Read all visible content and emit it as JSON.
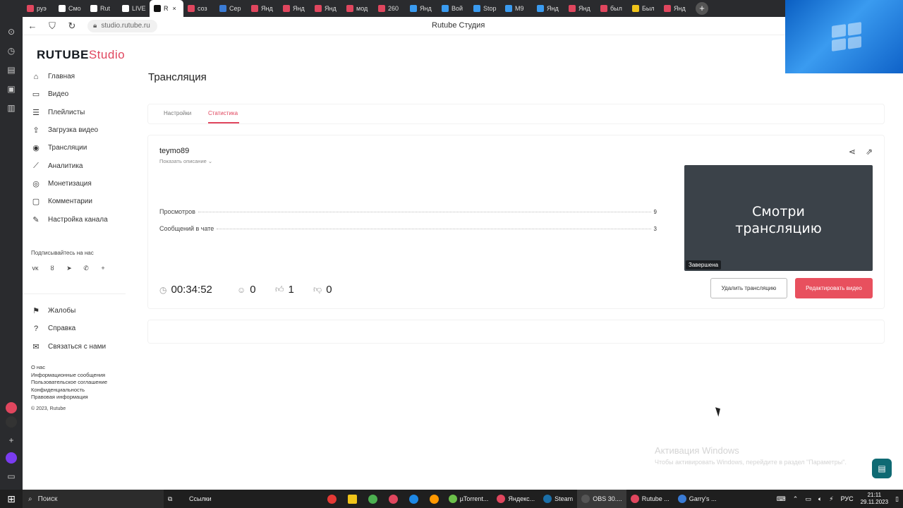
{
  "browser": {
    "tabs": [
      {
        "label": "руэ",
        "color": "#e0465e"
      },
      {
        "label": "Смо",
        "color": "#ffffff"
      },
      {
        "label": "Rut",
        "color": "#ffffff"
      },
      {
        "label": "LIVE",
        "color": "#ffffff"
      },
      {
        "label": "R",
        "color": "#111111",
        "active": true
      },
      {
        "label": "соз",
        "color": "#e0465e"
      },
      {
        "label": "Сер",
        "color": "#3a7bd5"
      },
      {
        "label": "Янд",
        "color": "#e0465e"
      },
      {
        "label": "Янд",
        "color": "#e0465e"
      },
      {
        "label": "Янд",
        "color": "#e0465e"
      },
      {
        "label": "мод",
        "color": "#e0465e"
      },
      {
        "label": "260",
        "color": "#e0465e"
      },
      {
        "label": "Янд",
        "color": "#3a9bf0"
      },
      {
        "label": "Вой",
        "color": "#3a9bf0"
      },
      {
        "label": "Stop",
        "color": "#3a9bf0"
      },
      {
        "label": "M9",
        "color": "#3a9bf0"
      },
      {
        "label": "Янд",
        "color": "#3a9bf0"
      },
      {
        "label": "Янд",
        "color": "#e0465e"
      },
      {
        "label": "был",
        "color": "#e0465e"
      },
      {
        "label": "Был",
        "color": "#f0c419"
      },
      {
        "label": "Янд",
        "color": "#e0465e"
      }
    ],
    "tab_close": "×",
    "new_tab": "+",
    "url": "studio.rutube.ru",
    "page_title": "Rutube Студия"
  },
  "sidebar": {
    "brand_main": "RUTUBE",
    "brand_accent": "Studio",
    "menu": [
      {
        "label": "Главная",
        "icon": "⌂",
        "name": "home"
      },
      {
        "label": "Видео",
        "icon": "▭",
        "name": "video"
      },
      {
        "label": "Плейлисты",
        "icon": "☰",
        "name": "playlists"
      },
      {
        "label": "Загрузка видео",
        "icon": "⇪",
        "name": "upload"
      },
      {
        "label": "Трансляции",
        "icon": "◉",
        "name": "streams"
      },
      {
        "label": "Аналитика",
        "icon": "⟋",
        "name": "analytics"
      },
      {
        "label": "Монетизация",
        "icon": "◎",
        "name": "monetization"
      },
      {
        "label": "Комментарии",
        "icon": "▢",
        "name": "comments"
      },
      {
        "label": "Настройка канала",
        "icon": "✎",
        "name": "channel-settings"
      }
    ],
    "subscribe_label": "Подписывайтесь на нас",
    "socials": [
      "vk",
      "ok",
      "tg",
      "viber",
      "+"
    ],
    "socials_glyphs": [
      "ᴠᴋ",
      "ȣ",
      "➤",
      "✆",
      "+"
    ],
    "menu2": [
      {
        "label": "Жалобы",
        "icon": "⚑",
        "name": "complaints"
      },
      {
        "label": "Справка",
        "icon": "?",
        "name": "help"
      },
      {
        "label": "Связаться с нами",
        "icon": "✉",
        "name": "contact"
      }
    ],
    "links": [
      "О нас",
      "Информационные сообщения",
      "Пользовательское соглашение",
      "Конфиденциальность",
      "Правовая информация"
    ],
    "copyright": "© 2023, Rutube"
  },
  "main": {
    "title": "Трансляция",
    "tabs": [
      {
        "label": "Настройки"
      },
      {
        "label": "Статистика",
        "active": true
      }
    ],
    "stream": {
      "name": "teymo89",
      "show_description": "Показать описание ⌄",
      "stats": [
        {
          "label": "Просмотров",
          "value": "9"
        },
        {
          "label": "Сообщений в чате",
          "value": "3"
        }
      ],
      "duration": "00:34:52",
      "comments": "0",
      "likes": "1",
      "dislikes": "0",
      "thumbnail_text_line1": "Смотри",
      "thumbnail_text_line2": "трансляцию",
      "status_badge": "Завершена",
      "delete_button": "Удалить трансляцию",
      "edit_button": "Редактировать видео"
    }
  },
  "overlay": {
    "activation_title": "Активация Windows",
    "activation_text": "Чтобы активировать Windows, перейдите в раздел \"Параметры\"."
  },
  "taskbar": {
    "search": "Поиск",
    "links": "Ссылки",
    "items": [
      {
        "label": "µTorrent...",
        "color": "#6cc04a"
      },
      {
        "label": "Яндекс...",
        "color": "#e0465e"
      },
      {
        "label": "Steam",
        "color": "#1b6fa8"
      },
      {
        "label": "OBS 30....",
        "color": "#555555",
        "active": true
      },
      {
        "label": "Rutube ...",
        "color": "#e0465e"
      },
      {
        "label": "Garry's ...",
        "color": "#3a7bd5"
      }
    ],
    "lang": "РУС",
    "time": "21:11",
    "date": "29.11.2023"
  },
  "colors": {
    "accent": "#e0465e",
    "button_primary": "#e8505e"
  }
}
